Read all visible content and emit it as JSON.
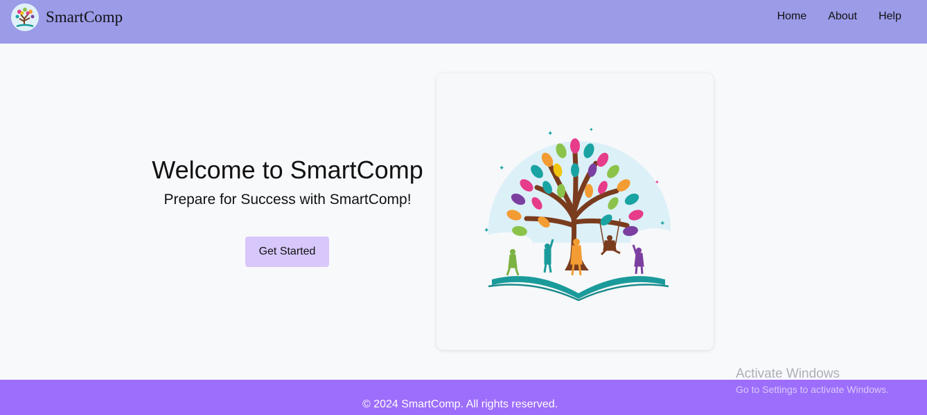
{
  "navbar": {
    "brand_name": "SmartComp",
    "links": [
      {
        "label": "Home"
      },
      {
        "label": "About"
      },
      {
        "label": "Help"
      }
    ]
  },
  "hero": {
    "title": "Welcome to SmartComp",
    "subtitle": "Prepare for Success with SmartComp!",
    "cta_label": "Get Started"
  },
  "footer": {
    "text": "© 2024 SmartComp. All rights reserved."
  },
  "watermark": {
    "title": "Activate Windows",
    "subtitle": "Go to Settings to activate Windows."
  },
  "colors": {
    "navbar_bg": "#9b9be8",
    "footer_bg": "#9d6dfc",
    "cta_bg": "#d7c7fb",
    "page_bg": "#f8f9fb"
  }
}
